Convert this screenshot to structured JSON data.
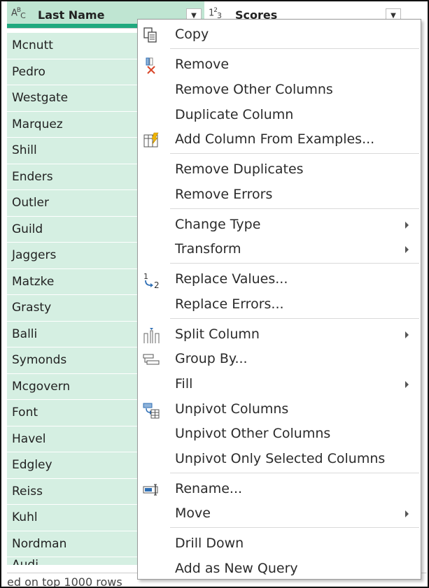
{
  "columns": {
    "last_name": {
      "type_icon": "ABC",
      "label": "Last Name"
    },
    "scores": {
      "type_icon": "123",
      "label": "Scores"
    }
  },
  "rows": [
    "Mcnutt",
    "Pedro",
    "Westgate",
    "Marquez",
    "Shill",
    "Enders",
    "Outler",
    "Guild",
    "Jaggers",
    "Matzke",
    "Grasty",
    "Balli",
    "Symonds",
    "Mcgovern",
    "Font",
    "Havel",
    "Edgley",
    "Reiss",
    "Kuhl",
    "Nordman",
    "Audi"
  ],
  "status": {
    "text": "ed on top 1000 rows"
  },
  "menu": {
    "items": [
      {
        "id": "copy",
        "label": "Copy",
        "icon": "copy-icon",
        "submenu": false
      },
      {
        "id": "remove",
        "label": "Remove",
        "icon": "remove-column-icon",
        "submenu": false
      },
      {
        "id": "remove-other-columns",
        "label": "Remove Other Columns",
        "icon": "",
        "submenu": false
      },
      {
        "id": "duplicate-column",
        "label": "Duplicate Column",
        "icon": "",
        "submenu": false
      },
      {
        "id": "add-column-from-examples",
        "label": "Add Column From Examples...",
        "icon": "add-column-examples-icon",
        "submenu": false
      },
      {
        "id": "remove-duplicates",
        "label": "Remove Duplicates",
        "icon": "",
        "submenu": false
      },
      {
        "id": "remove-errors",
        "label": "Remove Errors",
        "icon": "",
        "submenu": false
      },
      {
        "id": "change-type",
        "label": "Change Type",
        "icon": "",
        "submenu": true
      },
      {
        "id": "transform",
        "label": "Transform",
        "icon": "",
        "submenu": true
      },
      {
        "id": "replace-values",
        "label": "Replace Values...",
        "icon": "replace-values-icon",
        "submenu": false
      },
      {
        "id": "replace-errors",
        "label": "Replace Errors...",
        "icon": "",
        "submenu": false
      },
      {
        "id": "split-column",
        "label": "Split Column",
        "icon": "split-column-icon",
        "submenu": true
      },
      {
        "id": "group-by",
        "label": "Group By...",
        "icon": "group-by-icon",
        "submenu": false
      },
      {
        "id": "fill",
        "label": "Fill",
        "icon": "",
        "submenu": true
      },
      {
        "id": "unpivot-columns",
        "label": "Unpivot Columns",
        "icon": "unpivot-icon",
        "submenu": false
      },
      {
        "id": "unpivot-other-columns",
        "label": "Unpivot Other Columns",
        "icon": "",
        "submenu": false
      },
      {
        "id": "unpivot-only-selected-columns",
        "label": "Unpivot Only Selected Columns",
        "icon": "",
        "submenu": false
      },
      {
        "id": "rename",
        "label": "Rename...",
        "icon": "rename-icon",
        "submenu": false
      },
      {
        "id": "move",
        "label": "Move",
        "icon": "",
        "submenu": true
      },
      {
        "id": "drill-down",
        "label": "Drill Down",
        "icon": "",
        "submenu": false
      },
      {
        "id": "add-as-new-query",
        "label": "Add as New Query",
        "icon": "",
        "submenu": false
      }
    ]
  },
  "colors": {
    "selected_column_bg": "#d5efe2",
    "header_accent": "#1fa97e",
    "icon_blue": "#2f6fb5",
    "icon_red": "#d9472b"
  }
}
